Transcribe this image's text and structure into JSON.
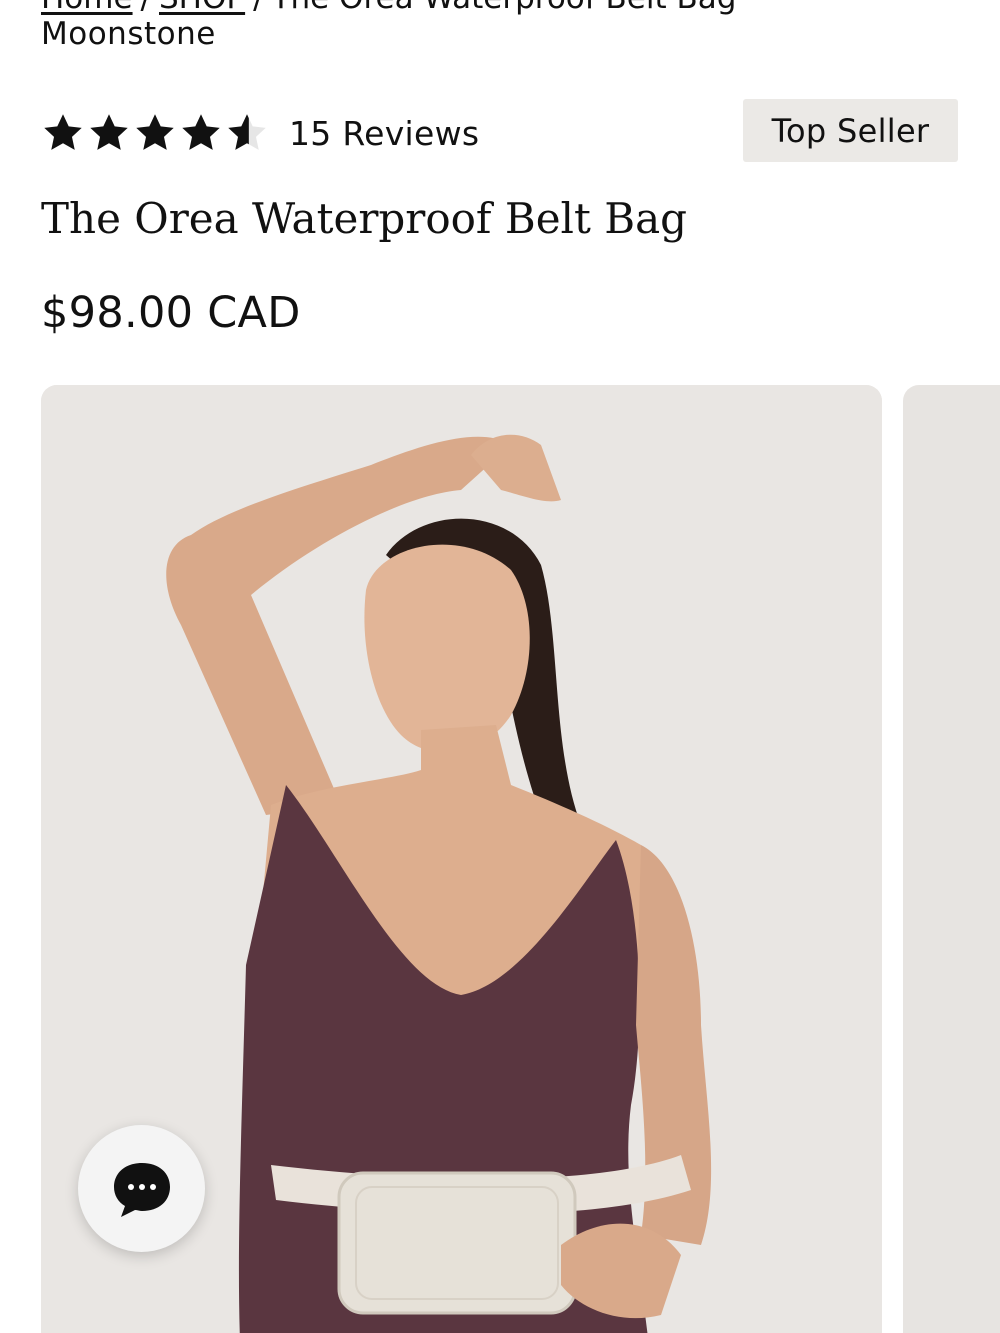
{
  "breadcrumb": {
    "home": "Home",
    "shop": "SHOP",
    "current_line1": "The Orea Waterproof Belt Bag",
    "current_line2": "Moonstone",
    "separator": "/"
  },
  "rating": {
    "stars": 4.5,
    "max_stars": 5,
    "reviews_label": "15 Reviews"
  },
  "badge": {
    "label": "Top Seller"
  },
  "product": {
    "title": "The Orea Waterproof Belt Bag",
    "price": "$98.00 CAD"
  },
  "gallery": {
    "image_alt": "Model wearing the Orea Waterproof Belt Bag in Moonstone"
  },
  "chat": {
    "icon": "chat-bubble-icon"
  },
  "colors": {
    "text": "#111111",
    "badge_bg": "#ebe9e6",
    "image_bg": "#e9e6e3",
    "swimsuit": "#5a3640",
    "bag": "#e6e1d8"
  }
}
